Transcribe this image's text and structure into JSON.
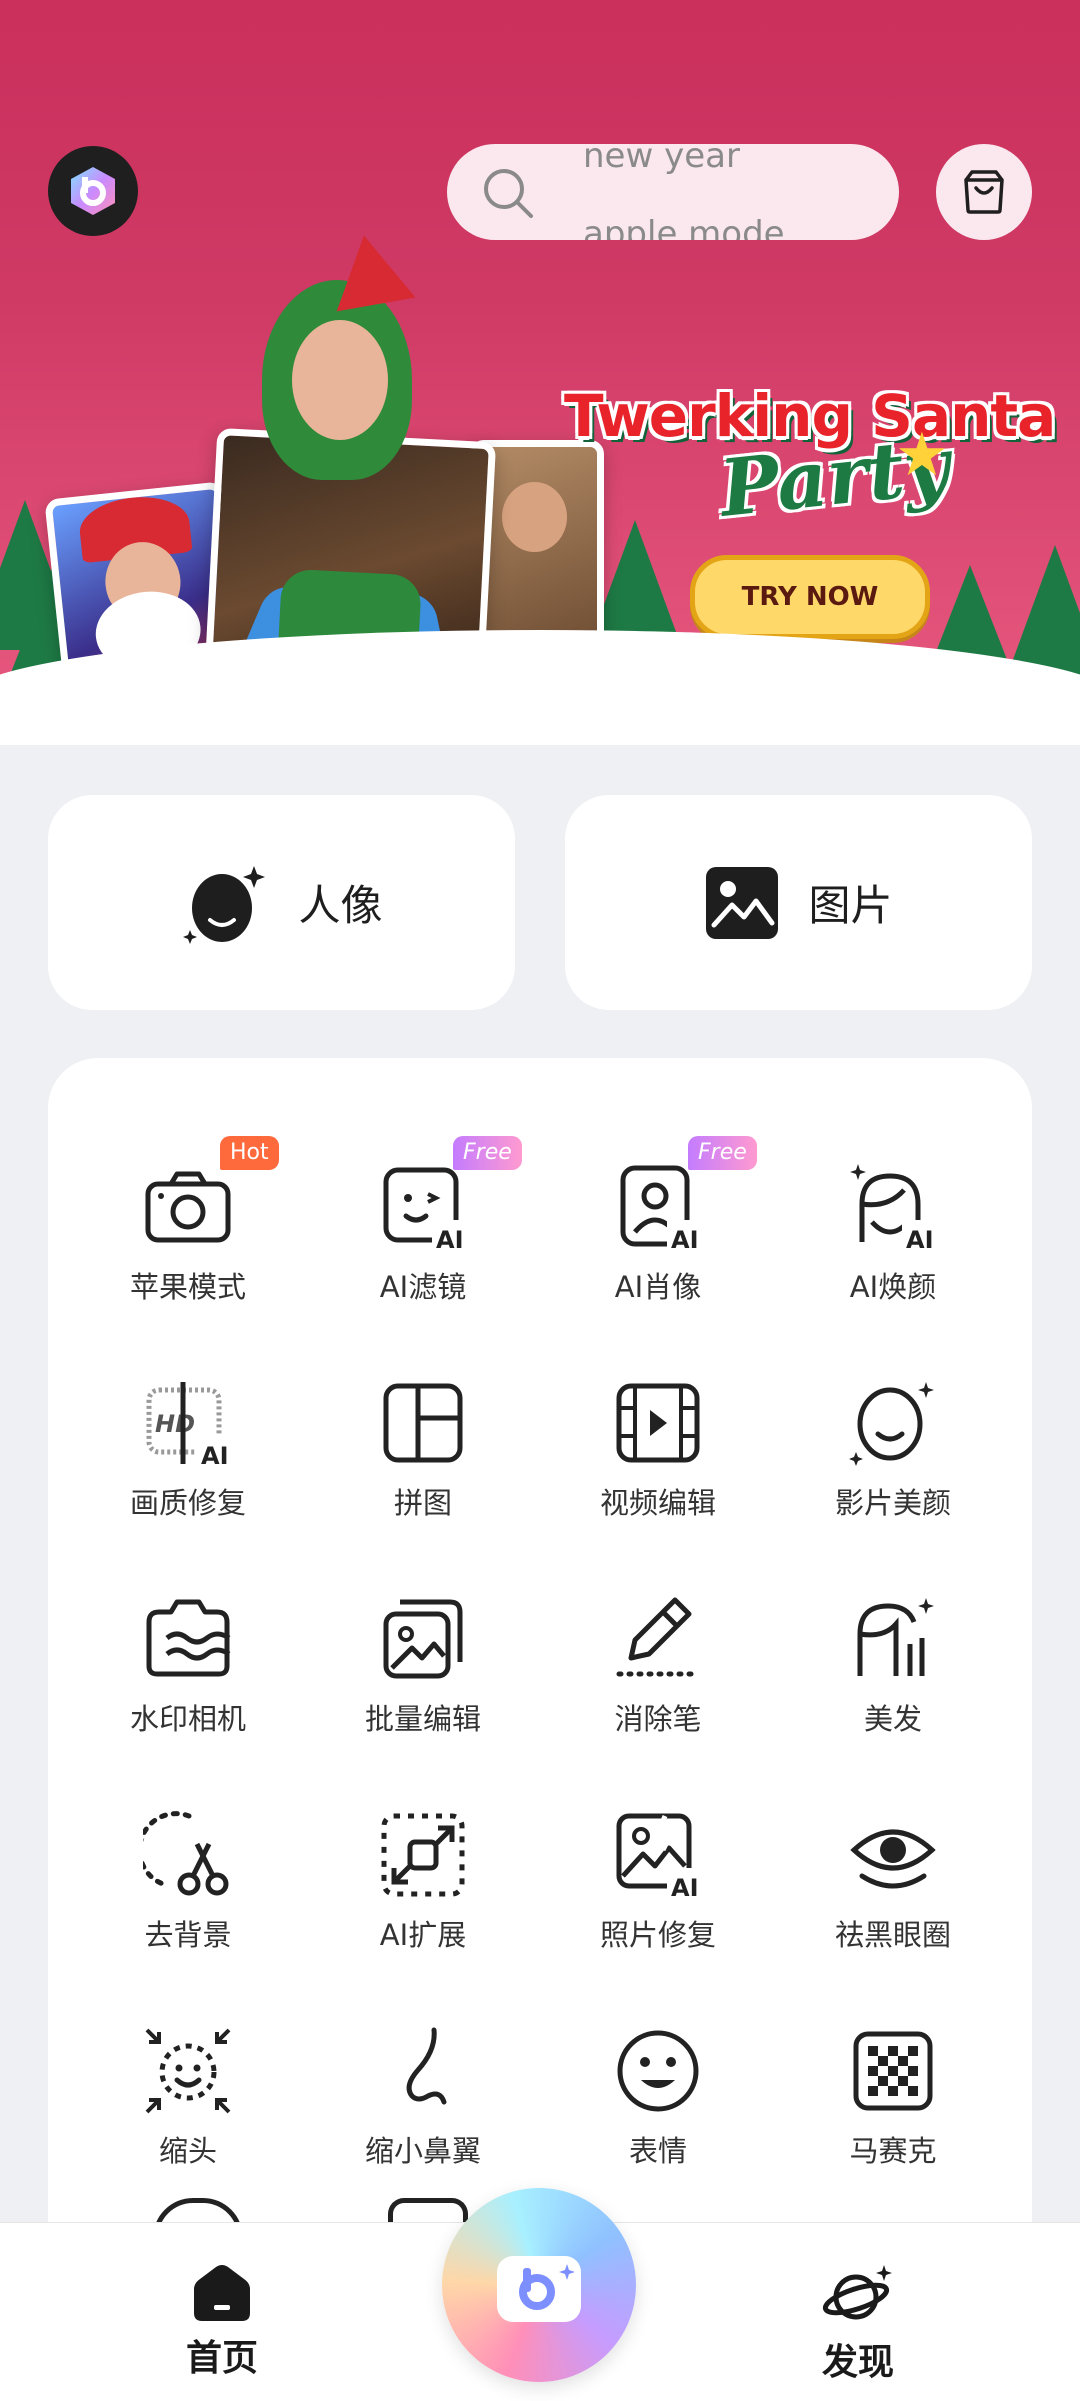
{
  "header": {
    "search_placeholder_current": "new year",
    "search_placeholder_next": "apple mode"
  },
  "banner": {
    "title_line1": "Twerking Santa",
    "title_line2": "Party",
    "cta_label": "TRY NOW"
  },
  "quick_actions": [
    {
      "label": "人像",
      "icon": "portrait-icon"
    },
    {
      "label": "图片",
      "icon": "image-icon"
    }
  ],
  "tools": [
    {
      "label": "苹果模式",
      "icon": "camera-icon",
      "badge": "Hot"
    },
    {
      "label": "AI滤镜",
      "icon": "ai-filter-icon",
      "badge": "Free"
    },
    {
      "label": "AI肖像",
      "icon": "ai-portrait-icon",
      "badge": "Free"
    },
    {
      "label": "AI焕颜",
      "icon": "ai-beauty-icon"
    },
    {
      "label": "画质修复",
      "icon": "hd-repair-icon"
    },
    {
      "label": "拼图",
      "icon": "collage-icon"
    },
    {
      "label": "视频编辑",
      "icon": "video-edit-icon"
    },
    {
      "label": "影片美颜",
      "icon": "video-beauty-icon"
    },
    {
      "label": "水印相机",
      "icon": "watermark-camera-icon"
    },
    {
      "label": "批量编辑",
      "icon": "batch-edit-icon"
    },
    {
      "label": "消除笔",
      "icon": "eraser-pen-icon"
    },
    {
      "label": "美发",
      "icon": "hair-icon"
    },
    {
      "label": "去背景",
      "icon": "remove-background-icon"
    },
    {
      "label": "AI扩展",
      "icon": "ai-expand-icon"
    },
    {
      "label": "照片修复",
      "icon": "photo-repair-icon"
    },
    {
      "label": "祛黑眼圈",
      "icon": "dark-circle-icon"
    },
    {
      "label": "缩头",
      "icon": "head-shrink-icon"
    },
    {
      "label": "缩小鼻翼",
      "icon": "nose-icon"
    },
    {
      "label": "表情",
      "icon": "expression-icon"
    },
    {
      "label": "马赛克",
      "icon": "mosaic-icon"
    }
  ],
  "bottom_nav": {
    "home_label": "首页",
    "discover_label": "发现"
  },
  "colors": {
    "banner_pink": "#cb2f5c",
    "hot_badge": "#ff6a3d",
    "tree_green": "#1e7a45"
  }
}
